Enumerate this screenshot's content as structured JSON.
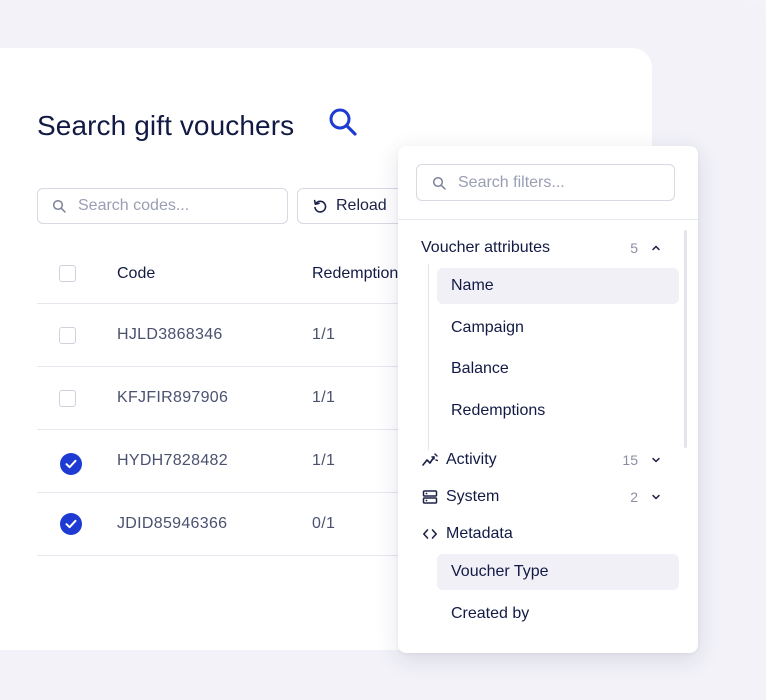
{
  "page": {
    "title": "Search gift vouchers"
  },
  "toolbar": {
    "search_placeholder": "Search codes...",
    "reload_label": "Reload"
  },
  "table": {
    "columns": [
      "Code",
      "Redemption"
    ],
    "rows": [
      {
        "code": "HJLD3868346",
        "redemption": "1/1",
        "checked": false
      },
      {
        "code": "KFJFIR897906",
        "redemption": "1/1",
        "checked": false
      },
      {
        "code": "HYDH7828482",
        "redemption": "1/1",
        "checked": true
      },
      {
        "code": "JDID85946366",
        "redemption": "0/1",
        "checked": true
      }
    ]
  },
  "filters": {
    "search_placeholder": "Search filters...",
    "groups": [
      {
        "label": "Voucher attributes",
        "count": "5",
        "expanded": true,
        "items": [
          "Name",
          "Campaign",
          "Balance",
          "Redemptions"
        ]
      },
      {
        "label": "Activity",
        "count": "15",
        "icon": "activity-icon",
        "expanded": false
      },
      {
        "label": "System",
        "count": "2",
        "icon": "server-icon",
        "expanded": false
      },
      {
        "label": "Metadata",
        "icon": "code-icon",
        "expanded": true,
        "items": [
          "Voucher Type",
          "Created by"
        ]
      }
    ]
  },
  "colors": {
    "accent": "#1d3bd3",
    "text": "#121a44",
    "muted": "#9a9eb3",
    "background": "#f3f3f9"
  }
}
